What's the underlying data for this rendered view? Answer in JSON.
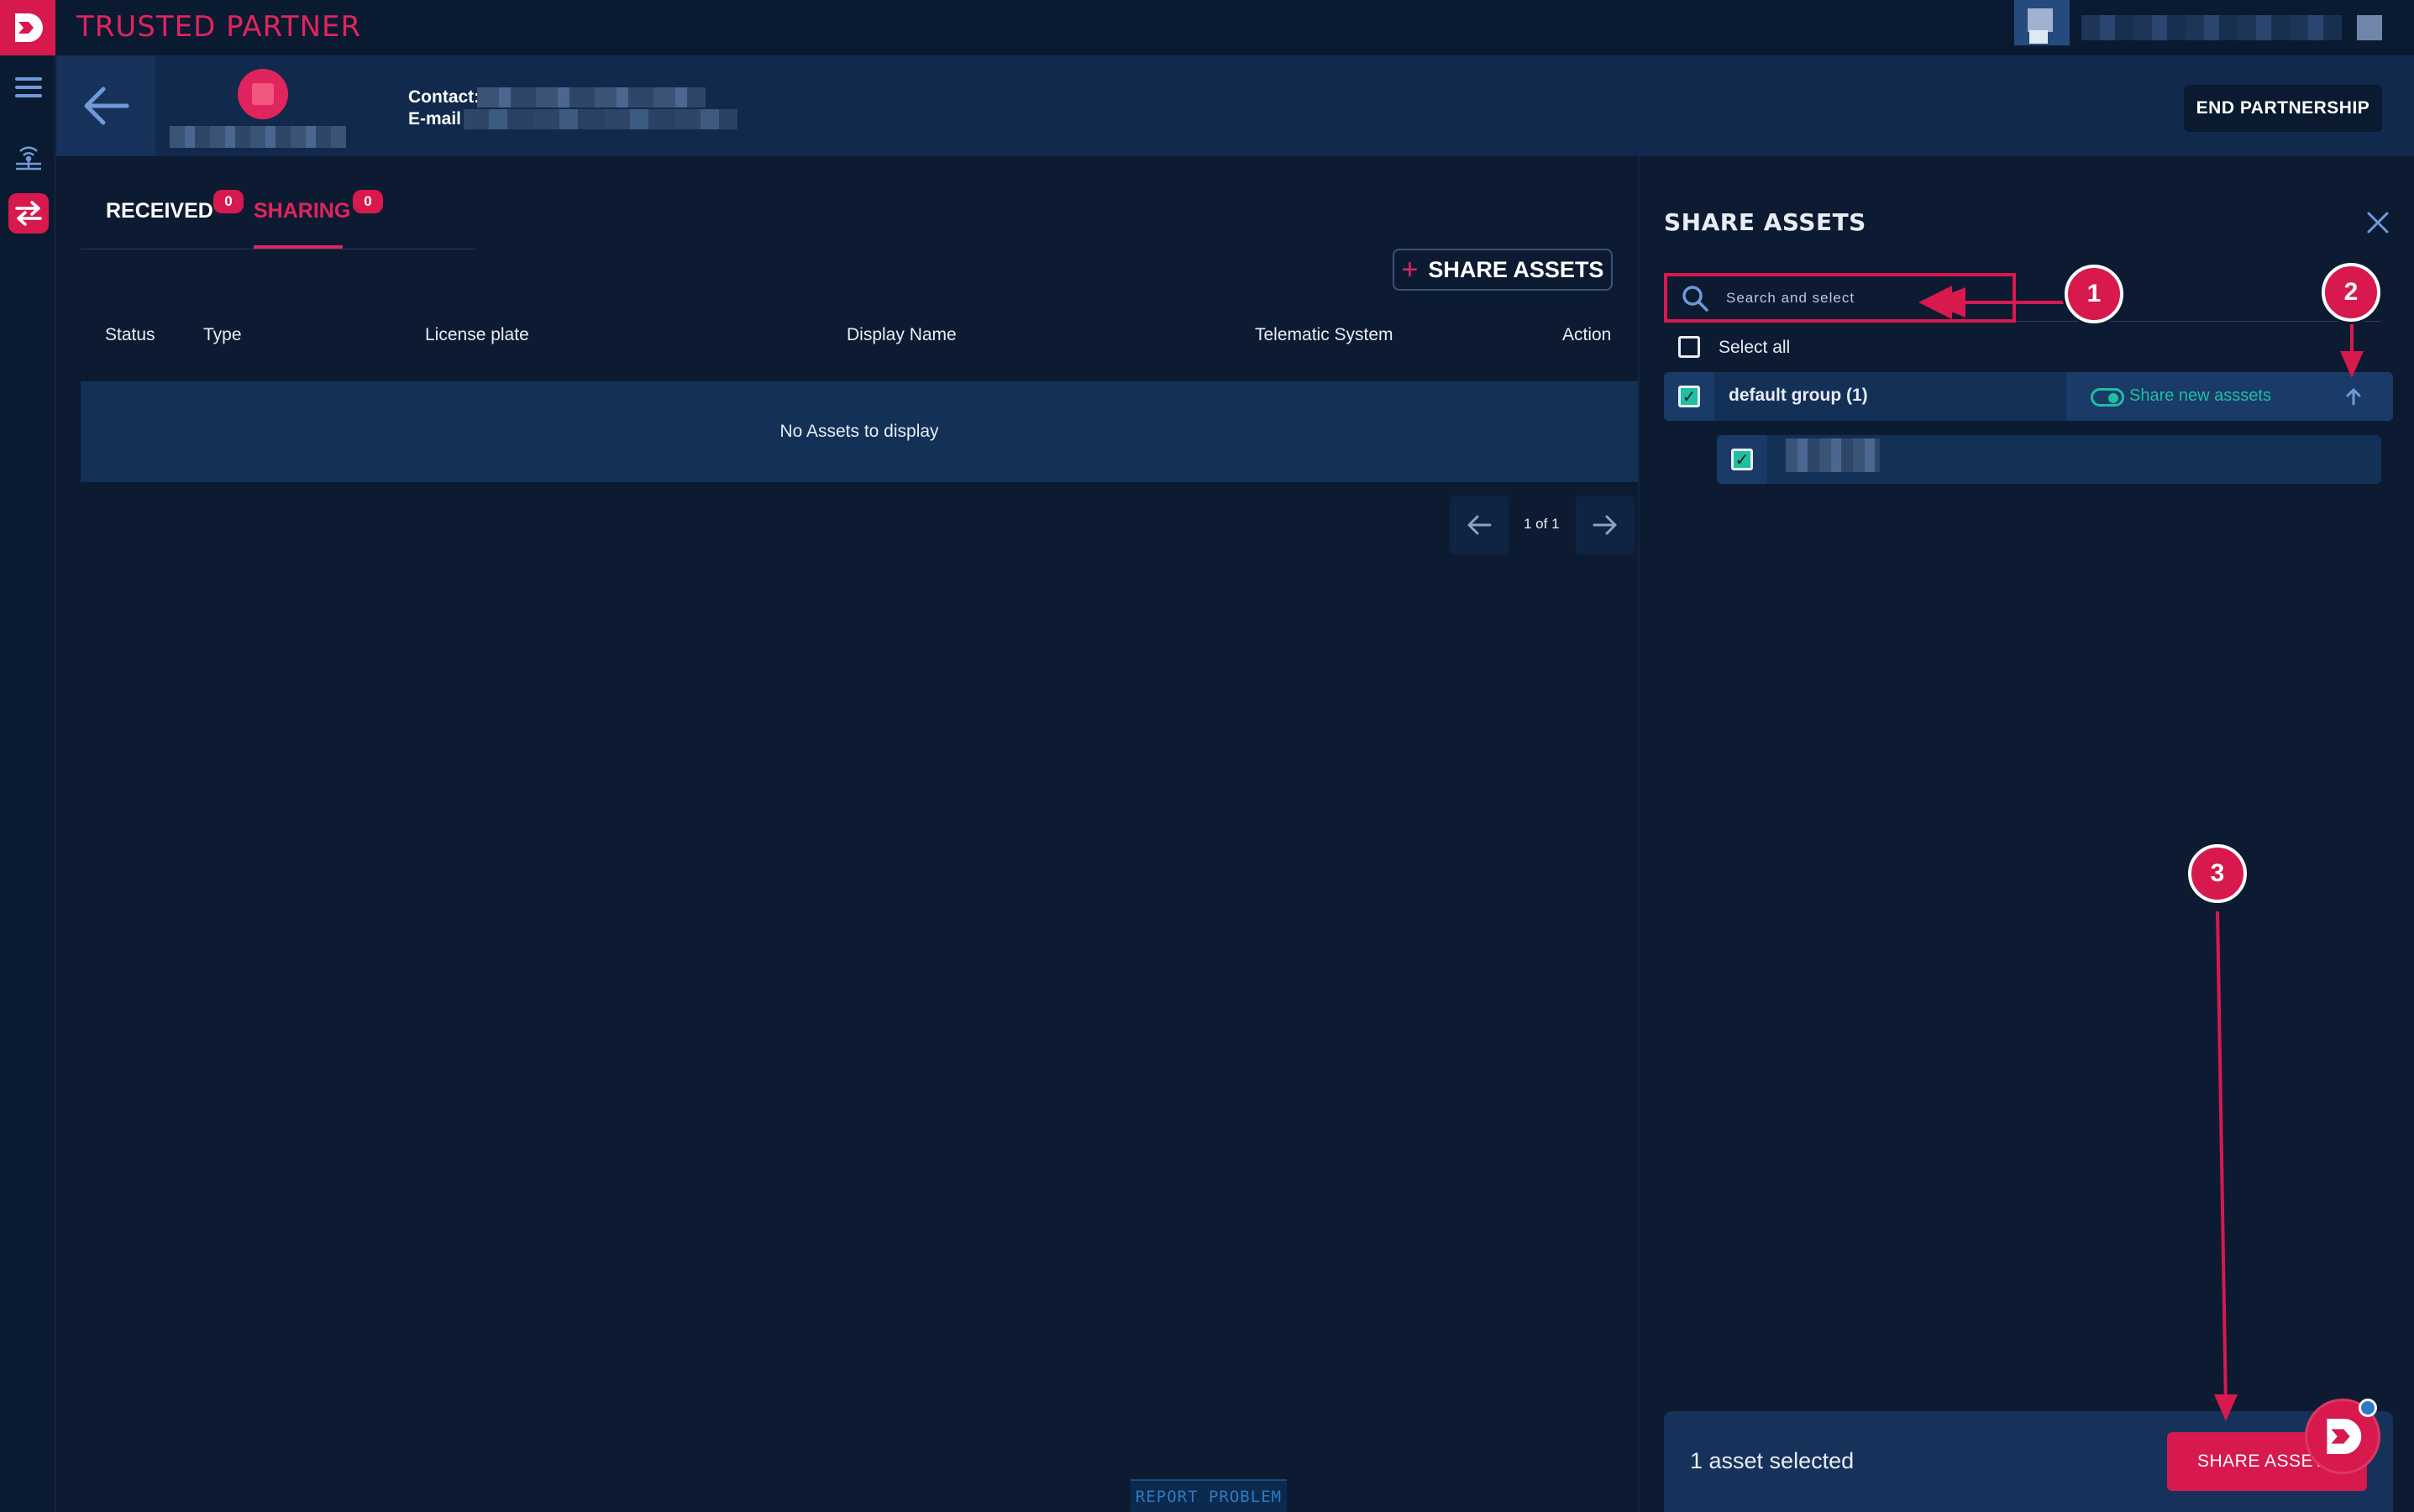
{
  "app": {
    "title": "TRUSTED PARTNER"
  },
  "partner": {
    "contact_label": "Contact:",
    "email_label": "E-mail :",
    "end_partnership": "END PARTNERSHIP"
  },
  "tabs": [
    {
      "label": "RECEIVED",
      "count": "0",
      "active": false
    },
    {
      "label": "SHARING",
      "count": "0",
      "active": true
    }
  ],
  "toolbar": {
    "share_assets": "SHARE ASSETS",
    "plus_glyph": "+"
  },
  "table": {
    "columns": [
      "Status",
      "Type",
      "License plate",
      "Display Name",
      "Telematic System",
      "Action"
    ],
    "empty_message": "No Assets to display"
  },
  "pagination": {
    "page_info": "1 of 1"
  },
  "footer": {
    "report_problem": "REPORT PROBLEM"
  },
  "share_panel": {
    "title": "SHARE ASSETS",
    "search_placeholder": "Search and select",
    "select_all": "Select all",
    "group_label": "default group (1)",
    "share_new_label": "Share new asssets",
    "selected_count": "1 asset selected",
    "submit_label": "SHARE ASSETS"
  },
  "annotations": [
    "1",
    "2",
    "3"
  ],
  "colors": {
    "accent": "#d7194d",
    "background": "#0d1b32",
    "header": "#11294d",
    "teal": "#1fbfa0"
  },
  "icons": {
    "logo": "brand-logo-icon",
    "menu": "hamburger-menu-icon",
    "signal": "signal-icon",
    "swap": "swap-arrows-icon",
    "back": "arrow-left-icon",
    "search": "search-icon",
    "close": "close-icon",
    "collapse": "arrow-up-icon",
    "prev": "arrow-left-icon",
    "next": "arrow-right-icon"
  }
}
